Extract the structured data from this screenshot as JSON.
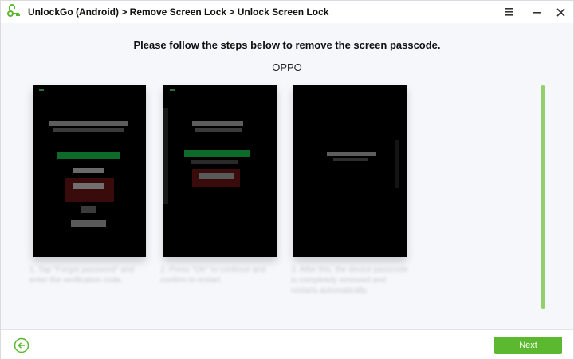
{
  "titlebar": {
    "breadcrumb": "UnlockGo (Android) > Remove Screen Lock > Unlock Screen Lock",
    "logo_icon": "unlockgo-logo-icon",
    "menu_icon": "menu-icon",
    "minimize_icon": "minimize-icon",
    "close_icon": "close-icon"
  },
  "main": {
    "heading": "Please follow the steps below to remove the screen passcode.",
    "brand": "OPPO",
    "steps": [
      {
        "caption": "1. Tap \"Forgot password\" and enter the verification code."
      },
      {
        "caption": "2. Press \"OK\" to continue and confirm to restart."
      },
      {
        "caption": "3. After this, the device passcode is completely removed and restarts automatically."
      }
    ]
  },
  "footer": {
    "back_icon": "back-arrow-icon",
    "next_label": "Next"
  },
  "colors": {
    "accent": "#5cb82f",
    "scrollbar": "#94cf6b",
    "background": "#f6f7fb"
  }
}
